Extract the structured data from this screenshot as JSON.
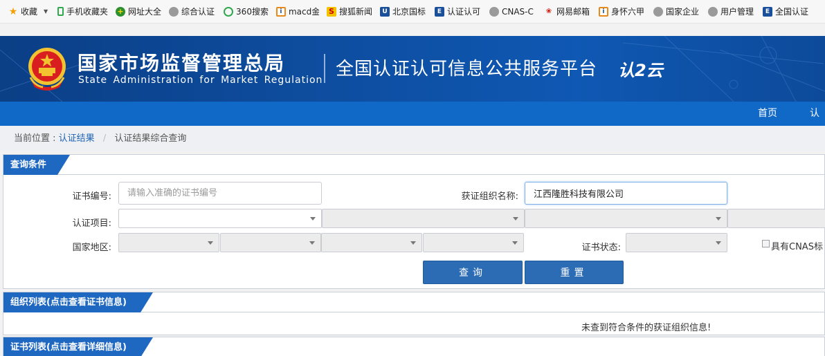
{
  "bookmarks": [
    {
      "label": "收藏",
      "icon": "star-icon"
    },
    {
      "label": "",
      "icon": "dropdown-caret-icon"
    },
    {
      "label": "手机收藏夹",
      "icon": "phone-icon"
    },
    {
      "label": "网址大全",
      "icon": "plus-circle-icon"
    },
    {
      "label": "综合认证",
      "icon": "globe-icon"
    },
    {
      "label": "360搜索",
      "icon": "search-360-icon"
    },
    {
      "label": "macd金",
      "icon": "macd-icon"
    },
    {
      "label": "搜狐新闻",
      "icon": "sohu-icon"
    },
    {
      "label": "北京国标",
      "icon": "site-icon"
    },
    {
      "label": "认证认可",
      "icon": "cert-icon"
    },
    {
      "label": "CNAS-C",
      "icon": "globe-icon"
    },
    {
      "label": "网易邮箱",
      "icon": "netease-icon"
    },
    {
      "label": "身怀六甲",
      "icon": "macd-icon"
    },
    {
      "label": "国家企业",
      "icon": "globe-icon"
    },
    {
      "label": "用户管理",
      "icon": "globe-icon"
    },
    {
      "label": "全国认证",
      "icon": "cert-icon"
    }
  ],
  "header": {
    "org_name_cn": "国家市场监督管理总局",
    "org_name_en": "State Administration  for  Market Regulation",
    "platform_title": "全国认证认可信息公共服务平台",
    "logo_text": "认2云"
  },
  "nav": {
    "items": [
      "首页",
      "认证"
    ]
  },
  "breadcrumb": {
    "prefix": "当前位置 :",
    "link": "认证结果",
    "current": "认证结果综合查询"
  },
  "query_panel": {
    "title": "查询条件",
    "cert_no_label": "证书编号:",
    "cert_no_placeholder": "请输入准确的证书编号",
    "org_name_label": "获证组织名称:",
    "org_name_value": "江西隆胜科技有限公司",
    "cert_project_label": "认证项目:",
    "region_label": "国家地区:",
    "cert_status_label": "证书状态:",
    "cnas_label": "具有CNAS标",
    "search_button": "查询",
    "reset_button": "重置"
  },
  "org_panel": {
    "title": "组织列表(点击查看证书信息)",
    "empty_message": "未查到符合条件的获证组织信息!"
  },
  "cert_panel": {
    "title": "证书列表(点击查看详细信息)"
  }
}
